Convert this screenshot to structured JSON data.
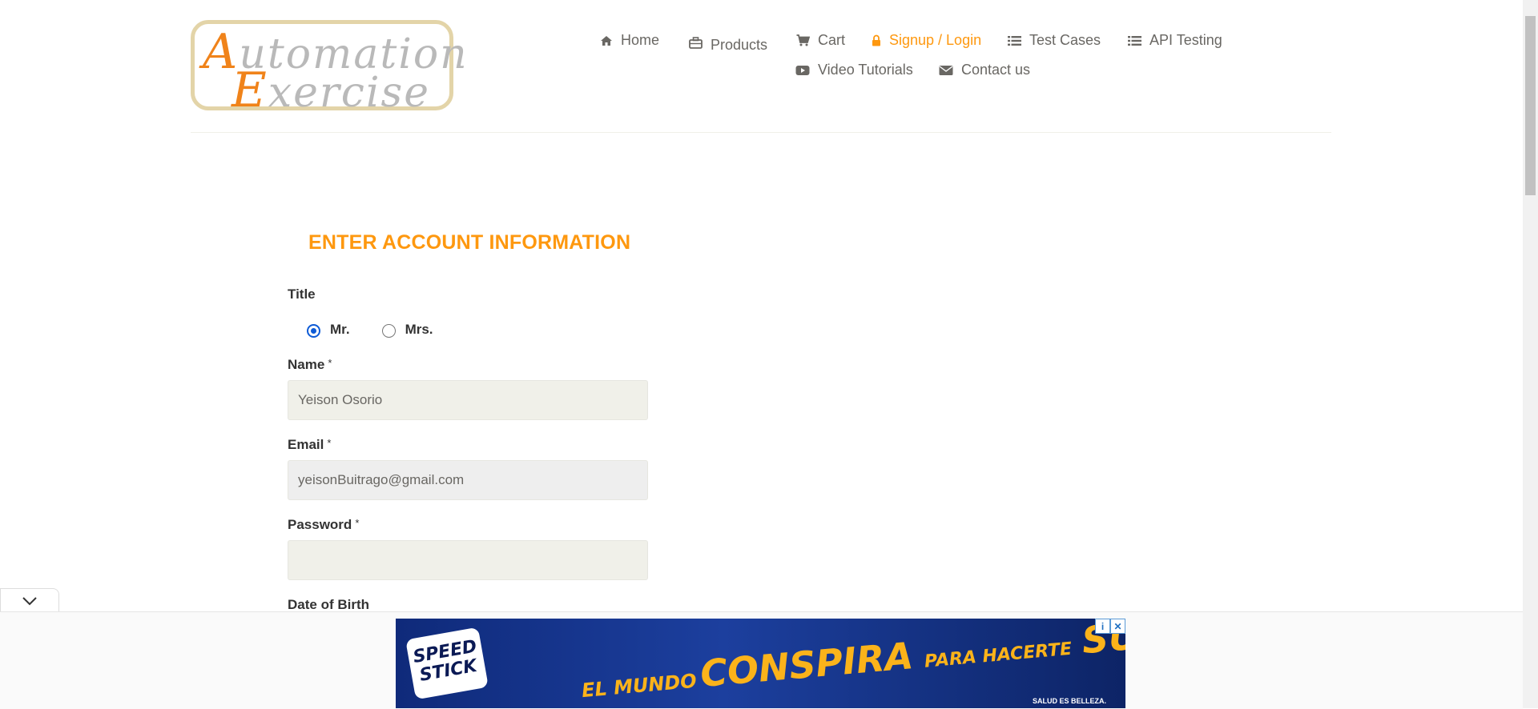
{
  "logo": {
    "line1": "utomation",
    "line1_cap": "A",
    "line2": "xercise",
    "line2_cap": "E"
  },
  "nav": {
    "home": "Home",
    "products": "Products",
    "cart": "Cart",
    "signup_login": "Signup / Login",
    "test_cases": "Test Cases",
    "api_testing": "API Testing",
    "video_tutorials": "Video Tutorials",
    "contact_us": "Contact us"
  },
  "form": {
    "heading": "ENTER ACCOUNT INFORMATION",
    "title_label": "Title",
    "title_options": [
      "Mr.",
      "Mrs."
    ],
    "title_selected": "Mr.",
    "name_label": "Name",
    "name_value": "Yeison Osorio",
    "email_label": "Email",
    "email_value": "yeisonBuitrago@gmail.com",
    "password_label": "Password",
    "password_value": "",
    "required_mark": "*",
    "dob_label": "Date of Birth"
  },
  "ad": {
    "brand_line1": "SPEED",
    "brand_line2": "STICK",
    "headline_w1": "EL MUNDO",
    "headline_w2": "CONSPIRA",
    "headline_w3": "PARA HACERTE",
    "headline_w4": "SUDAR",
    "tagline": "SALUD ES BELLEZA.",
    "info_icon": "i",
    "close_icon": "✕"
  },
  "colors": {
    "accent": "#fe980f",
    "text": "#696763",
    "field_bg": "#f0f0e9",
    "radio_checked": "#0e5bd6"
  }
}
